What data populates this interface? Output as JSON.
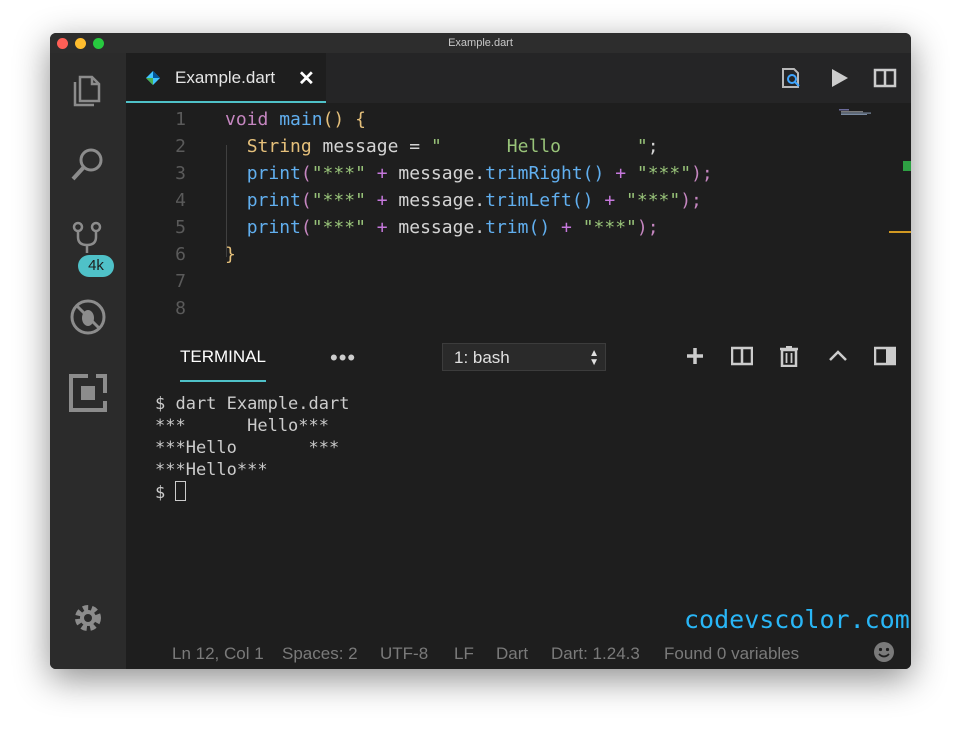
{
  "window": {
    "title": "Example.dart"
  },
  "activity_bar": {
    "source_control_badge": "4k"
  },
  "tab": {
    "label": "Example.dart",
    "close": "✕"
  },
  "editor": {
    "line_numbers": [
      "1",
      "2",
      "3",
      "4",
      "5",
      "6",
      "7",
      "8"
    ],
    "lines": {
      "l1": {
        "kw": "void",
        "fn": "main",
        "parens": "()",
        "brace": "{"
      },
      "l2": {
        "type": "String",
        "rest": " message = ",
        "str": "\"      Hello       \"",
        "semi": ";"
      },
      "l3": {
        "fn": "print",
        "open": "(",
        "s1": "\"***\"",
        "plus1": " + ",
        "obj": "message",
        "dot": ".",
        "method": "trimRight",
        "call": "()",
        "plus2": " + ",
        "s2": "\"***\"",
        "close": ");"
      },
      "l4": {
        "fn": "print",
        "open": "(",
        "s1": "\"***\"",
        "plus1": " + ",
        "obj": "message",
        "dot": ".",
        "method": "trimLeft",
        "call": "()",
        "plus2": " + ",
        "s2": "\"***\"",
        "close": ");"
      },
      "l5": {
        "fn": "print",
        "open": "(",
        "s1": "\"***\"",
        "plus1": " + ",
        "obj": "message",
        "dot": ".",
        "method": "trim",
        "call": "()",
        "plus2": " + ",
        "s2": "\"***\"",
        "close": ");"
      },
      "l6": {
        "brace": "}"
      }
    }
  },
  "panel": {
    "tab_label": "TERMINAL",
    "more": "•••",
    "shell_select": "1: bash",
    "terminal_lines": [
      "$ dart Example.dart",
      "***      Hello***",
      "***Hello       ***",
      "***Hello***",
      "$ "
    ]
  },
  "watermark": "codevscolor.com",
  "status_bar": {
    "position": "Ln 12, Col 1",
    "spaces": "Spaces: 2",
    "encoding": "UTF-8",
    "eol": "LF",
    "language": "Dart",
    "sdk": "Dart: 1.24.3",
    "variables": "Found 0 variables"
  },
  "colors": {
    "accent": "#4fc1c8",
    "keyword": "#c586c0",
    "function": "#61afef",
    "type": "#e5c07b",
    "string": "#98c379",
    "watermark": "#29b6f6"
  },
  "icons": {
    "activity": [
      "explorer-icon",
      "search-icon",
      "source-control-icon",
      "debug-icon",
      "extensions-icon",
      "settings-gear-icon"
    ],
    "editor_actions": [
      "open-preview-icon",
      "run-icon",
      "split-editor-icon",
      "more-actions-icon"
    ],
    "panel_actions": [
      "new-terminal-icon",
      "split-terminal-icon",
      "kill-terminal-icon",
      "maximize-panel-icon",
      "toggle-panel-position-icon",
      "close-panel-icon"
    ],
    "status": [
      "feedback-smiley-icon",
      "notifications-bell-icon"
    ]
  }
}
